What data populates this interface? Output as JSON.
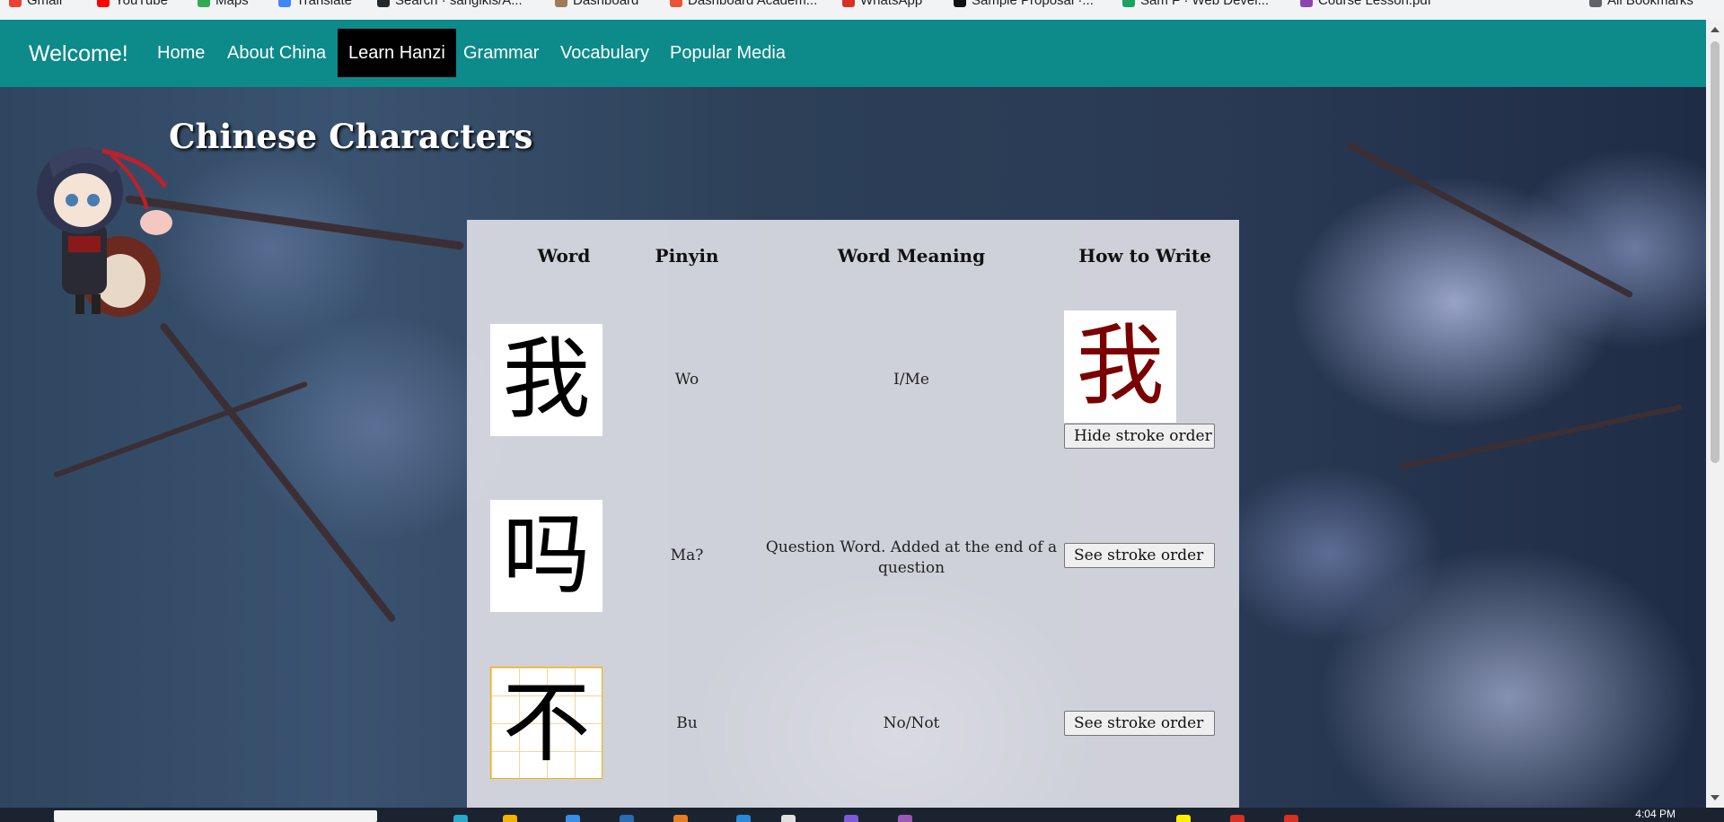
{
  "bookmarks": [
    {
      "label": "Gmail",
      "color": "#ea4335"
    },
    {
      "label": "YouTube",
      "color": "#ff0000"
    },
    {
      "label": "Maps",
      "color": "#34a853"
    },
    {
      "label": "Translate",
      "color": "#4285f4"
    },
    {
      "label": "Search · sangikis/A...",
      "color": "#24292e"
    },
    {
      "label": "Dashboard",
      "color": "#9e7b5b"
    },
    {
      "label": "Dashboard Academ...",
      "color": "#e8543a"
    },
    {
      "label": "WhatsApp",
      "color": "#d93025"
    },
    {
      "label": "Sample Proposal ·...",
      "color": "#111111"
    },
    {
      "label": "Sam F · Web Devel...",
      "color": "#1aa260"
    },
    {
      "label": "Course Lesson.pdf",
      "color": "#8e44ad"
    },
    {
      "label": "All Bookmarks",
      "color": "#5f6368"
    }
  ],
  "nav": {
    "brand": "Welcome!",
    "links": [
      "Home",
      "About China",
      "Learn Hanzi",
      "Grammar",
      "Vocabulary",
      "Popular Media"
    ],
    "active": "Learn Hanzi"
  },
  "page": {
    "title": "Chinese Characters"
  },
  "table": {
    "headers": [
      "Word",
      "Pinyin",
      "Word Meaning",
      "How to Write"
    ],
    "rows": [
      {
        "character": "我",
        "pinyin": "Wo",
        "meaning": "I/Me",
        "stroke_preview": "我",
        "button": "Hide stroke order"
      },
      {
        "character": "吗",
        "pinyin": "Ma?",
        "meaning": "Question Word. Added at the end of a question",
        "button": "See stroke order"
      },
      {
        "character": "不",
        "pinyin": "Bu",
        "meaning": "No/Not",
        "button": "See stroke order"
      }
    ]
  },
  "colors": {
    "navbar": "#0d8a8a",
    "nav_active": "#000000",
    "stroke_red": "#7a0000"
  },
  "taskbar": {
    "clock": "4:04 PM"
  }
}
